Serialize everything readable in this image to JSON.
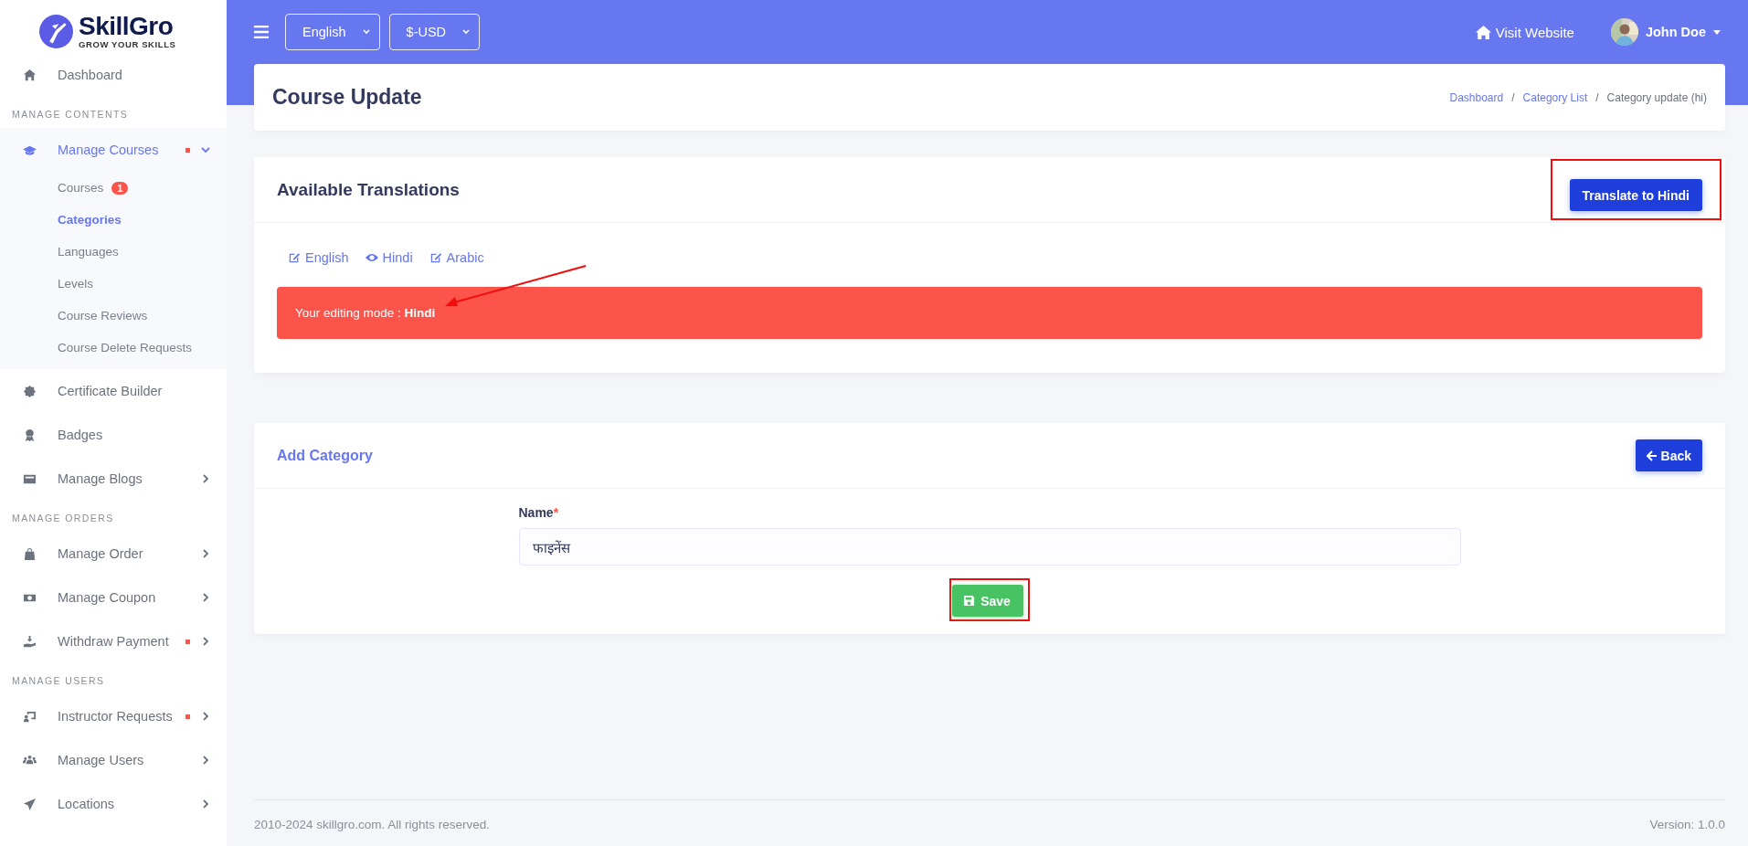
{
  "brand": {
    "name": "SkillGro",
    "tagline": "GROW YOUR SKILLS"
  },
  "sidebar": {
    "items": [
      {
        "kind": "link",
        "label": "Dashboard",
        "selected": false,
        "expandable": false,
        "expanded": false,
        "notification": false
      },
      {
        "kind": "section",
        "label": "MANAGE CONTENTS"
      },
      {
        "kind": "link",
        "label": "Manage Courses",
        "selected": true,
        "expandable": true,
        "expanded": true,
        "notification": true,
        "children": [
          {
            "label": "Courses",
            "selected": false,
            "badge": "1"
          },
          {
            "label": "Categories",
            "selected": true
          },
          {
            "label": "Languages",
            "selected": false
          },
          {
            "label": "Levels",
            "selected": false
          },
          {
            "label": "Course Reviews",
            "selected": false
          },
          {
            "label": "Course Delete Requests",
            "selected": false
          }
        ]
      },
      {
        "kind": "link",
        "label": "Certificate Builder",
        "selected": false,
        "expandable": false,
        "expanded": false,
        "notification": false
      },
      {
        "kind": "link",
        "label": "Badges",
        "selected": false,
        "expandable": false,
        "expanded": false,
        "notification": false
      },
      {
        "kind": "link",
        "label": "Manage Blogs",
        "selected": false,
        "expandable": true,
        "expanded": false,
        "notification": false
      },
      {
        "kind": "section",
        "label": "MANAGE ORDERS"
      },
      {
        "kind": "link",
        "label": "Manage Order",
        "selected": false,
        "expandable": true,
        "expanded": false,
        "notification": false
      },
      {
        "kind": "link",
        "label": "Manage Coupon",
        "selected": false,
        "expandable": true,
        "expanded": false,
        "notification": false
      },
      {
        "kind": "link",
        "label": "Withdraw Payment",
        "selected": false,
        "expandable": true,
        "expanded": false,
        "notification": true
      },
      {
        "kind": "section",
        "label": "MANAGE USERS"
      },
      {
        "kind": "link",
        "label": "Instructor Requests",
        "selected": false,
        "expandable": true,
        "expanded": false,
        "notification": true
      },
      {
        "kind": "link",
        "label": "Manage Users",
        "selected": false,
        "expandable": true,
        "expanded": false,
        "notification": false
      },
      {
        "kind": "link",
        "label": "Locations",
        "selected": false,
        "expandable": true,
        "expanded": false,
        "notification": false
      }
    ]
  },
  "topbar": {
    "language": "English",
    "currency": "$-USD",
    "visit_website": "Visit Website",
    "user": "John Doe"
  },
  "page_header": {
    "title": "Course Update",
    "separator": "/",
    "breadcrumb": [
      {
        "label": "Dashboard",
        "kind": "link"
      },
      {
        "label": "Category List",
        "kind": "link"
      },
      {
        "label": "Category update (hi)",
        "kind": "current"
      }
    ]
  },
  "translations": {
    "title": "Available Translations",
    "button": "Translate to Hindi",
    "button_highlighted": true,
    "languages": [
      {
        "label": "English",
        "selected": false
      },
      {
        "label": "Hindi",
        "selected": true
      },
      {
        "label": "Arabic",
        "selected": false
      }
    ],
    "alert": "Your editing mode : **Hindi**",
    "alert_arrow": true
  },
  "form": {
    "title": "Add Category",
    "back_button": "Back",
    "field_label": "Name",
    "required_mark": "*",
    "field_value": "फाइनेंस",
    "save_button": "Save",
    "save_highlighted": true
  },
  "footer": {
    "copyright": "2010-2024 skillgro.com. All rights reserved.",
    "version": "Version: 1.0.0"
  }
}
